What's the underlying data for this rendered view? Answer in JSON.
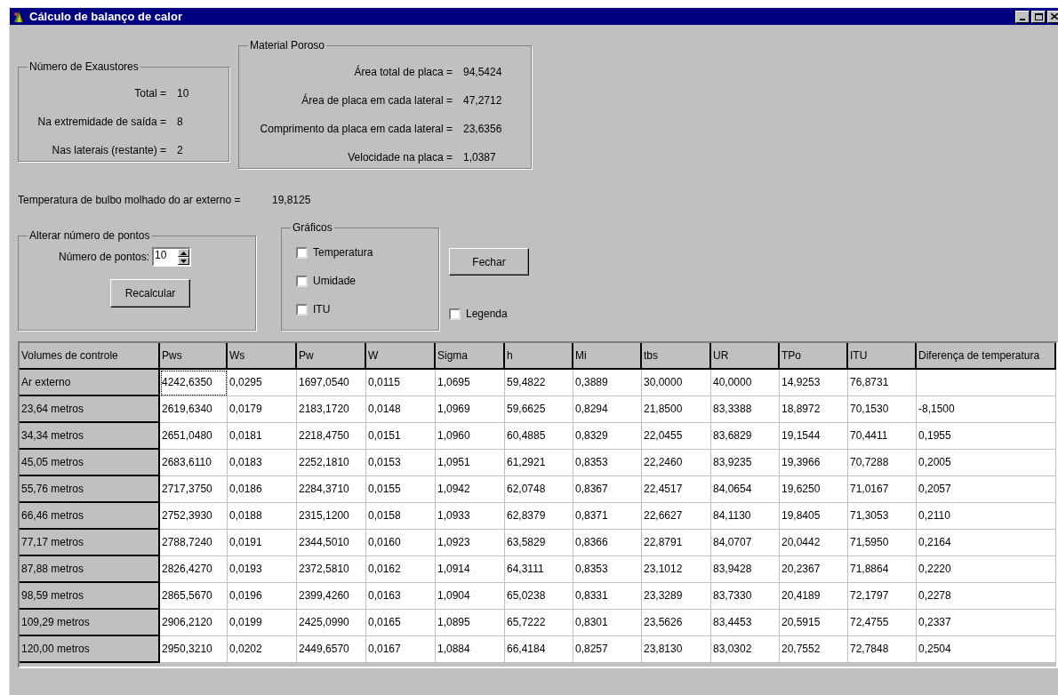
{
  "window": {
    "title": "Cálculo de balanço de calor"
  },
  "exhausts": {
    "title": "Número de Exaustores",
    "rows": [
      {
        "label": "Total =",
        "value": "10"
      },
      {
        "label": "Na extremidade de saída =",
        "value": "8"
      },
      {
        "label": "Nas laterais (restante) =",
        "value": "2"
      }
    ]
  },
  "porous_material": {
    "title": "Material Poroso",
    "rows": [
      {
        "label": "Área total de placa =",
        "value": "94,5424"
      },
      {
        "label": "Área de placa em cada lateral =",
        "value": "47,2712"
      },
      {
        "label": "Comprimento da placa em cada lateral =",
        "value": "23,6356"
      },
      {
        "label": "Velocidade na placa =",
        "value": "1,0387"
      }
    ]
  },
  "wet_bulb": {
    "label": "Temperatura de bulbo molhado do ar externo =",
    "value": "19,8125"
  },
  "points": {
    "title": "Alterar número de pontos",
    "label": "Número de pontos:",
    "value": "10",
    "button": "Recalcular"
  },
  "charts": {
    "title": "Gráficos",
    "options": [
      {
        "label": "Temperatura",
        "checked": false
      },
      {
        "label": "Umidade",
        "checked": false
      },
      {
        "label": "ITU",
        "checked": false
      }
    ]
  },
  "close_button": "Fechar",
  "legend": {
    "label": "Legenda",
    "checked": false
  },
  "table": {
    "columns": [
      "Volumes de controle",
      "Pws",
      "Ws",
      "Pw",
      "W",
      "Sigma",
      "h",
      "Mi",
      "tbs",
      "UR",
      "TPo",
      "ITU",
      "Diferença de temperatura"
    ],
    "rows": [
      {
        "focused": true,
        "cells": [
          "Ar externo",
          "4242,6350",
          "0,0295",
          "1697,0540",
          "0,0115",
          "1,0695",
          "59,4822",
          "0,3889",
          "30,0000",
          "40,0000",
          "14,9253",
          "76,8731",
          ""
        ]
      },
      {
        "focused": false,
        "cells": [
          "23,64 metros",
          "2619,6340",
          "0,0179",
          "2183,1720",
          "0,0148",
          "1,0969",
          "59,6625",
          "0,8294",
          "21,8500",
          "83,3388",
          "18,8972",
          "70,1530",
          "-8,1500"
        ]
      },
      {
        "focused": false,
        "cells": [
          "34,34 metros",
          "2651,0480",
          "0,0181",
          "2218,4750",
          "0,0151",
          "1,0960",
          "60,4885",
          "0,8329",
          "22,0455",
          "83,6829",
          "19,1544",
          "70,4411",
          "0,1955"
        ]
      },
      {
        "focused": false,
        "cells": [
          "45,05 metros",
          "2683,6110",
          "0,0183",
          "2252,1810",
          "0,0153",
          "1,0951",
          "61,2921",
          "0,8353",
          "22,2460",
          "83,9235",
          "19,3966",
          "70,7288",
          "0,2005"
        ]
      },
      {
        "focused": false,
        "cells": [
          "55,76 metros",
          "2717,3750",
          "0,0186",
          "2284,3710",
          "0,0155",
          "1,0942",
          "62,0748",
          "0,8367",
          "22,4517",
          "84,0654",
          "19,6250",
          "71,0167",
          "0,2057"
        ]
      },
      {
        "focused": false,
        "cells": [
          "66,46 metros",
          "2752,3930",
          "0,0188",
          "2315,1200",
          "0,0158",
          "1,0933",
          "62,8379",
          "0,8371",
          "22,6627",
          "84,1130",
          "19,8405",
          "71,3053",
          "0,2110"
        ]
      },
      {
        "focused": false,
        "cells": [
          "77,17 metros",
          "2788,7240",
          "0,0191",
          "2344,5010",
          "0,0160",
          "1,0923",
          "63,5829",
          "0,8366",
          "22,8791",
          "84,0707",
          "20,0442",
          "71,5950",
          "0,2164"
        ]
      },
      {
        "focused": false,
        "cells": [
          "87,88 metros",
          "2826,4270",
          "0,0193",
          "2372,5810",
          "0,0162",
          "1,0914",
          "64,3111",
          "0,8353",
          "23,1012",
          "83,9428",
          "20,2367",
          "71,8864",
          "0,2220"
        ]
      },
      {
        "focused": false,
        "cells": [
          "98,59 metros",
          "2865,5670",
          "0,0196",
          "2399,4260",
          "0,0163",
          "1,0904",
          "65,0238",
          "0,8331",
          "23,3289",
          "83,7330",
          "20,4189",
          "72,1797",
          "0,2278"
        ]
      },
      {
        "focused": false,
        "cells": [
          "109,29 metros",
          "2906,2120",
          "0,0199",
          "2425,0990",
          "0,0165",
          "1,0895",
          "65,7222",
          "0,8301",
          "23,5626",
          "83,4453",
          "20,5915",
          "72,4755",
          "0,2337"
        ]
      },
      {
        "focused": false,
        "cells": [
          "120,00 metros",
          "2950,3210",
          "0,0202",
          "2449,6570",
          "0,0167",
          "1,0884",
          "66,4184",
          "0,8257",
          "23,8130",
          "83,0302",
          "20,7552",
          "72,7848",
          "0,2504"
        ]
      }
    ]
  }
}
